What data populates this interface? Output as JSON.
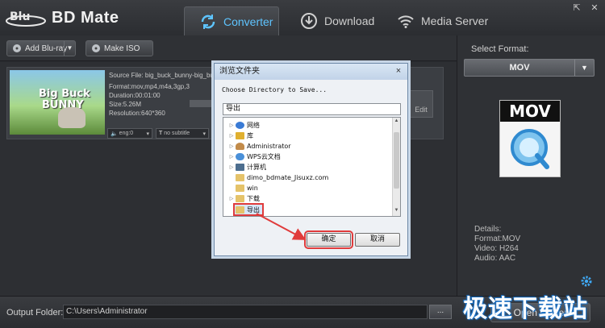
{
  "app": {
    "title": "BD Mate",
    "tabs": [
      {
        "label": "Converter",
        "icon": "refresh-icon",
        "active": true
      },
      {
        "label": "Download",
        "icon": "download-icon"
      },
      {
        "label": "Media Server",
        "icon": "wifi-icon"
      }
    ],
    "window_buttons": [
      "restore-icon",
      "close-icon"
    ]
  },
  "toolbar": {
    "add_label": "Add Blu-ray",
    "iso_label": "Make ISO"
  },
  "item": {
    "thumb_text_1": "Big Buck",
    "thumb_text_2": "BUNNY",
    "source": "Source File: big_buck_bunny-big_bu",
    "format": "Format:mov,mp4,m4a,3gp,3",
    "duration": "Duration:00:01:00",
    "size": "Size:5.26M",
    "resolution": "Resolution:640*360",
    "audio": "eng:0",
    "subtitle": "no subtitle",
    "edit_label": "Edit"
  },
  "right_panel": {
    "select_label": "Select Format:",
    "format_value": "MOV",
    "icon_text": "MOV",
    "details": [
      "Details:",
      "Format:MOV",
      "Video: H264",
      "Audio: AAC"
    ]
  },
  "output": {
    "label": "Output Folder:",
    "path": "C:\\Users\\Administrator",
    "browse": "...",
    "open": "Open Folder"
  },
  "dialog": {
    "title": "浏览文件夹",
    "close": "×",
    "prompt": "Choose Directory to Save...",
    "folder": "导出",
    "tree": [
      {
        "label": "网络",
        "icon": "network-icon",
        "color": "#3a7bd5"
      },
      {
        "label": "库",
        "icon": "library-icon",
        "color": "#e0b030"
      },
      {
        "label": "Administrator",
        "icon": "user-icon",
        "color": "#c28b4a"
      },
      {
        "label": "WPS云文档",
        "icon": "cloud-icon",
        "color": "#4a90d9"
      },
      {
        "label": "计算机",
        "icon": "computer-icon",
        "color": "#4d6e8f"
      },
      {
        "label": "dimo_bdmate_Jisuxz.com",
        "icon": "folder-icon",
        "color": "#e5c36a"
      },
      {
        "label": "win",
        "icon": "folder-icon",
        "color": "#e5c36a"
      },
      {
        "label": "下载",
        "icon": "folder-icon",
        "color": "#e5c36a"
      },
      {
        "label": "导出",
        "icon": "folder-icon",
        "color": "#e5c36a"
      }
    ],
    "ok": "确定",
    "cancel": "取消"
  },
  "watermark": "极速下载站",
  "colors": {
    "accent": "#5ec4ff",
    "highlight": "#e03b3b"
  }
}
